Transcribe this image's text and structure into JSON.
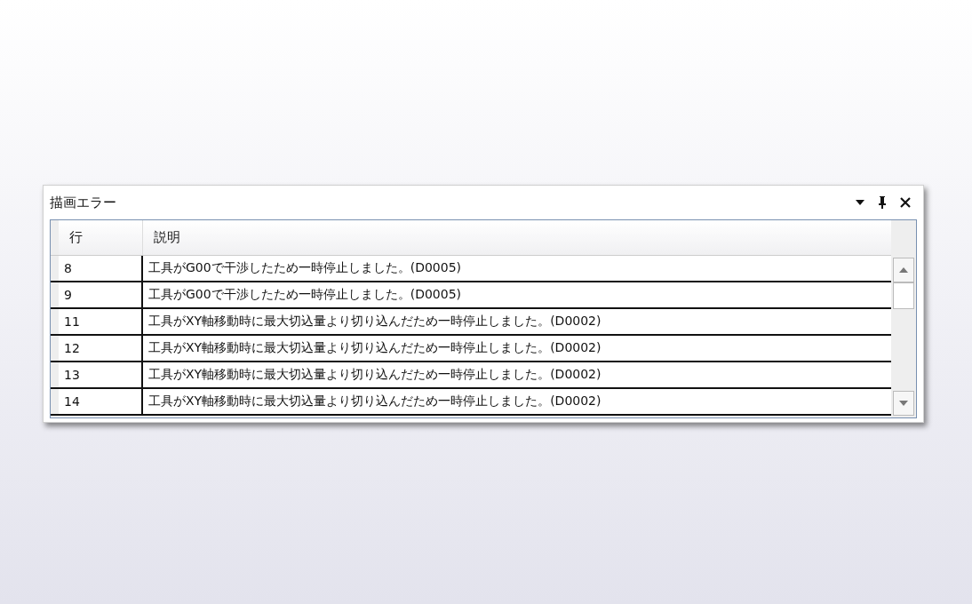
{
  "panel": {
    "title": "描画エラー"
  },
  "table": {
    "columns": [
      "行",
      "説明"
    ],
    "rows": [
      {
        "line": "8",
        "description": "工具がG00で干渉したため一時停止しました。(D0005)"
      },
      {
        "line": "9",
        "description": "工具がG00で干渉したため一時停止しました。(D0005)"
      },
      {
        "line": "11",
        "description": "工具がXY軸移動時に最大切込量より切り込んだため一時停止しました。(D0002)"
      },
      {
        "line": "12",
        "description": "工具がXY軸移動時に最大切込量より切り込んだため一時停止しました。(D0002)"
      },
      {
        "line": "13",
        "description": "工具がXY軸移動時に最大切込量より切り込んだため一時停止しました。(D0002)"
      },
      {
        "line": "14",
        "description": "工具がXY軸移動時に最大切込量より切り込んだため一時停止しました。(D0002)"
      }
    ]
  }
}
